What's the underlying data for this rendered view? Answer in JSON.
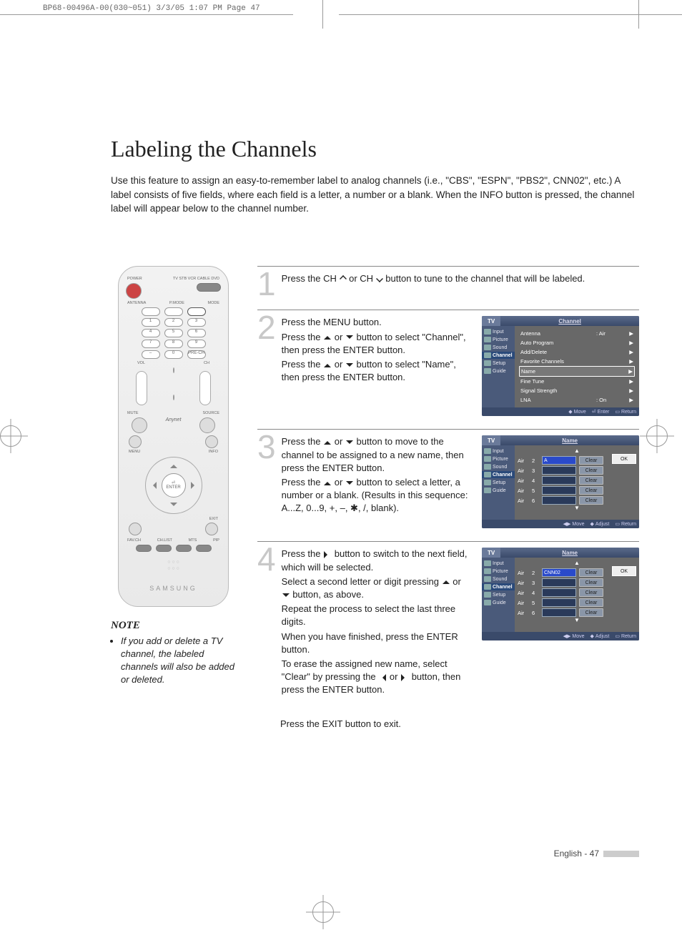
{
  "crop_header": "BP68-00496A-00(030~051)  3/3/05  1:07 PM  Page 47",
  "title": "Labeling the Channels",
  "intro": "Use this feature to assign an easy-to-remember label to analog channels (i.e., \"CBS\", \"ESPN\", \"PBS2\", CNN02\", etc.) A label consists of five fields, where each field is a letter, a number or a blank. When the INFO button is pressed, the channel label will appear below to the channel number.",
  "remote": {
    "brand": "SAMSUNG",
    "top_labels": {
      "power": "POWER",
      "modes": "TV  STB  VCR  CABLE  DVD"
    },
    "row2_labels": {
      "l": "ANTENNA",
      "m": "P.MODE",
      "r": "MODE"
    },
    "numpad": [
      [
        "1",
        "2",
        "3"
      ],
      [
        "4",
        "5",
        "6"
      ],
      [
        "7",
        "8",
        "9"
      ],
      [
        "–",
        "0",
        "PRE-CH"
      ]
    ],
    "mid_labels": {
      "vol": "VOL",
      "ch": "CH",
      "mute": "MUTE",
      "source": "SOURCE"
    },
    "diag": {
      "tl": "MENU",
      "tr": "INFO",
      "bl": "",
      "br": "EXIT"
    },
    "enter": "ENTER",
    "bottom4": [
      "FAV.CH",
      "CH.LIST",
      "MTS",
      "PIP"
    ]
  },
  "note_title": "NOTE",
  "note_text": "If you add or delete a TV channel, the labeled channels will also be added or deleted.",
  "steps": [
    {
      "num": "1",
      "lines": [
        "Press the CH ∧ or CH ∨ button to tune to the channel that will be labeled."
      ]
    },
    {
      "num": "2",
      "lines": [
        "Press the MENU button.",
        "Press the ▲ or ▼ button to select \"Channel\", then press the ENTER button.",
        "Press the ▲ or ▼ button to select \"Name\", then press the ENTER button."
      ]
    },
    {
      "num": "3",
      "lines": [
        "Press the ▲ or ▼ button to move to the channel to be assigned to a new name, then press the ENTER button.",
        "Press the ▲ or ▼ button to select a letter, a number or a blank. (Results in this sequence: A...Z, 0...9, +, –, ✱, /, blank)."
      ]
    },
    {
      "num": "4",
      "lines": [
        "Press the ▶ button to switch to the next field, which will be selected.",
        "Select a second letter or digit pressing ▲ or ▼ button, as above.",
        "Repeat the process to select the last three digits.",
        "When you have finished, press the ENTER button.",
        "To erase the assigned new name, select \"Clear\" by pressing the ◀ or ▶ button, then press the ENTER button."
      ]
    }
  ],
  "final_line": "Press the EXIT button to exit.",
  "osd_sidebar": [
    "Input",
    "Picture",
    "Sound",
    "Channel",
    "Setup",
    "Guide"
  ],
  "osd_tv_label": "TV",
  "osd1": {
    "title": "Channel",
    "rows": [
      {
        "k": "Antenna",
        "v": ": Air",
        "arrow": true,
        "boxed": false
      },
      {
        "k": "Auto Program",
        "v": "",
        "arrow": true,
        "boxed": false
      },
      {
        "k": "Add/Delete",
        "v": "",
        "arrow": true,
        "boxed": false
      },
      {
        "k": "Favorite Channels",
        "v": "",
        "arrow": true,
        "boxed": false
      },
      {
        "k": "Name",
        "v": "",
        "arrow": true,
        "boxed": true
      },
      {
        "k": "Fine Tune",
        "v": "",
        "arrow": true,
        "boxed": false
      },
      {
        "k": "Signal Strength",
        "v": "",
        "arrow": true,
        "boxed": false
      },
      {
        "k": "LNA",
        "v": ": On",
        "arrow": true,
        "boxed": false
      }
    ],
    "footer": [
      "Move",
      "Enter",
      "Return"
    ]
  },
  "osd2": {
    "title": "Name",
    "ok": "OK",
    "rows": [
      {
        "src": "Air",
        "num": "2",
        "val": "A",
        "clear": "Clear"
      },
      {
        "src": "Air",
        "num": "3",
        "val": "",
        "clear": "Clear"
      },
      {
        "src": "Air",
        "num": "4",
        "val": "",
        "clear": "Clear"
      },
      {
        "src": "Air",
        "num": "5",
        "val": "",
        "clear": "Clear"
      },
      {
        "src": "Air",
        "num": "6",
        "val": "",
        "clear": "Clear"
      }
    ],
    "footer": [
      "Move",
      "Adjust",
      "Return"
    ]
  },
  "osd3": {
    "title": "Name",
    "ok": "OK",
    "rows": [
      {
        "src": "Air",
        "num": "2",
        "val": "CNN02",
        "clear": "Clear"
      },
      {
        "src": "Air",
        "num": "3",
        "val": "",
        "clear": "Clear"
      },
      {
        "src": "Air",
        "num": "4",
        "val": "",
        "clear": "Clear"
      },
      {
        "src": "Air",
        "num": "5",
        "val": "",
        "clear": "Clear"
      },
      {
        "src": "Air",
        "num": "6",
        "val": "",
        "clear": "Clear"
      }
    ],
    "footer": [
      "Move",
      "Adjust",
      "Return"
    ]
  },
  "page_footer": "English - 47"
}
